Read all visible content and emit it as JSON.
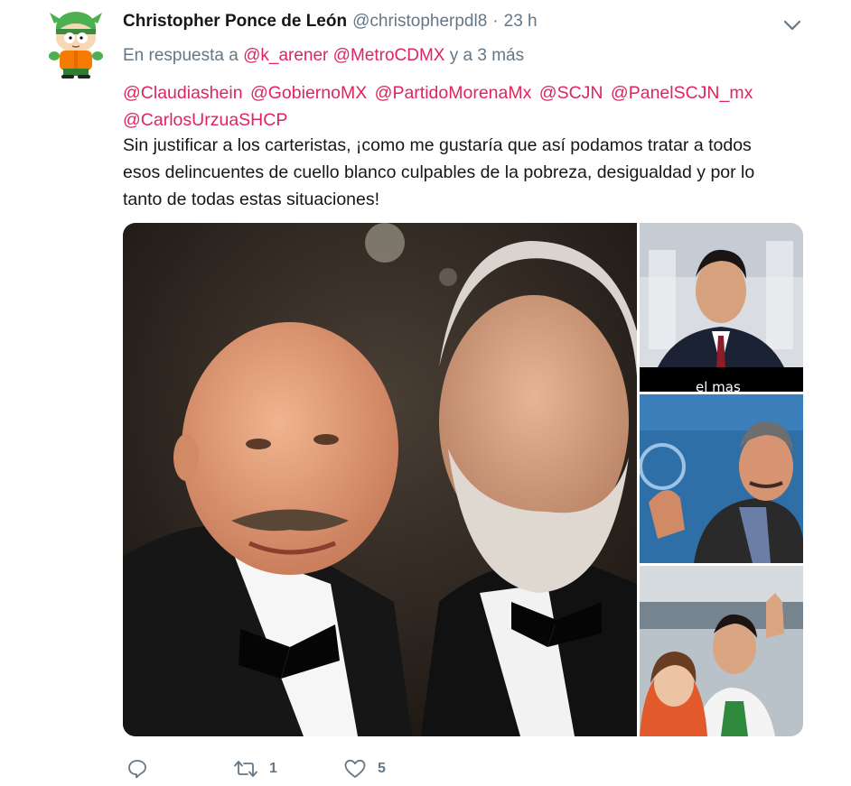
{
  "author": {
    "display_name": "Christopher Ponce de León",
    "handle": "@christopherpdl8",
    "separator": "·",
    "timestamp": "23 h",
    "avatar_icon": "kyle-cartoon-avatar"
  },
  "reply_to": {
    "prefix": "En respuesta a",
    "users": [
      "@k_arener",
      "@MetroCDMX"
    ],
    "suffix": "y a 3 más"
  },
  "mentions": [
    "@Claudiashein",
    "@GobiernoMX",
    "@PartidoMorenaMx",
    "@SCJN",
    "@PanelSCJN_mx",
    "@CarlosUrzuaSHCP"
  ],
  "body": {
    "line1": "Sin justificar a los carteristas, ¡como  me gustaría que así podamos tratar a todos",
    "line2": "esos delincuentes de cuello blanco culpables de la pobreza, desigualdad y por lo",
    "line3": "tanto de todas estas situaciones!"
  },
  "media": {
    "photo_count": 4,
    "caption_text": "el mas"
  },
  "actions": {
    "reply_icon": "reply-icon",
    "retweet_icon": "retweet-icon",
    "retweet_count": "1",
    "like_icon": "heart-icon",
    "like_count": "5"
  },
  "colors": {
    "link": "#e0245e",
    "muted": "#657786",
    "text": "#14171a"
  }
}
